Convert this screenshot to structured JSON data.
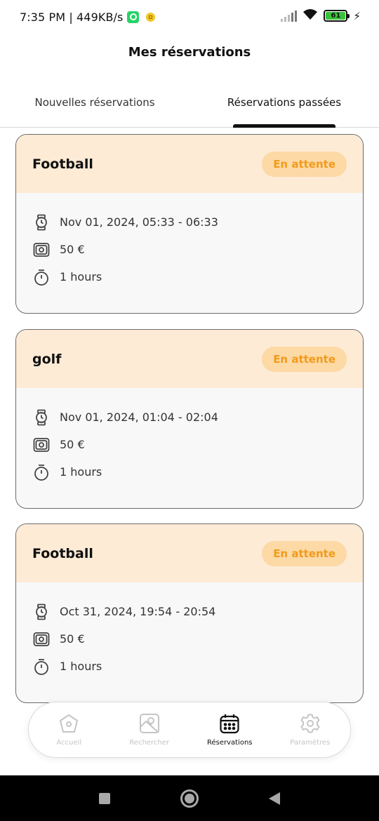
{
  "status_bar": {
    "time_speed": "7:35 PM | 449KB/s",
    "battery_level": "61",
    "icons": [
      "whatsapp-icon",
      "notification-icon",
      "signal-icon",
      "wifi-icon",
      "battery-icon",
      "charging-icon"
    ]
  },
  "header": {
    "title": "Mes réservations"
  },
  "tabs": [
    {
      "label": "Nouvelles réservations",
      "active": false
    },
    {
      "label": "Réservations passées",
      "active": true
    }
  ],
  "reservations": [
    {
      "sport": "Football",
      "status": "En attente",
      "datetime": "Nov 01, 2024, 05:33 - 06:33",
      "price": "50 €",
      "duration": "1 hours"
    },
    {
      "sport": "golf",
      "status": "En attente",
      "datetime": "Nov 01, 2024, 01:04 - 02:04",
      "price": "50 €",
      "duration": "1 hours"
    },
    {
      "sport": "Football",
      "status": "En attente",
      "datetime": "Oct 31, 2024, 19:54 - 20:54",
      "price": "50 €",
      "duration": "1 hours"
    }
  ],
  "bottom_nav": [
    {
      "label": "Accueil",
      "icon": "home-icon",
      "active": false
    },
    {
      "label": "Rechercher",
      "icon": "map-search-icon",
      "active": false
    },
    {
      "label": "Réservations",
      "icon": "calendar-icon",
      "active": true
    },
    {
      "label": "Paramètres",
      "icon": "settings-icon",
      "active": false
    }
  ],
  "colors": {
    "card_header_bg": "#fdebd6",
    "badge_bg": "#fcd9a5",
    "badge_text": "#f29a1b",
    "active": "#111111",
    "inactive": "#c5c5c5"
  }
}
